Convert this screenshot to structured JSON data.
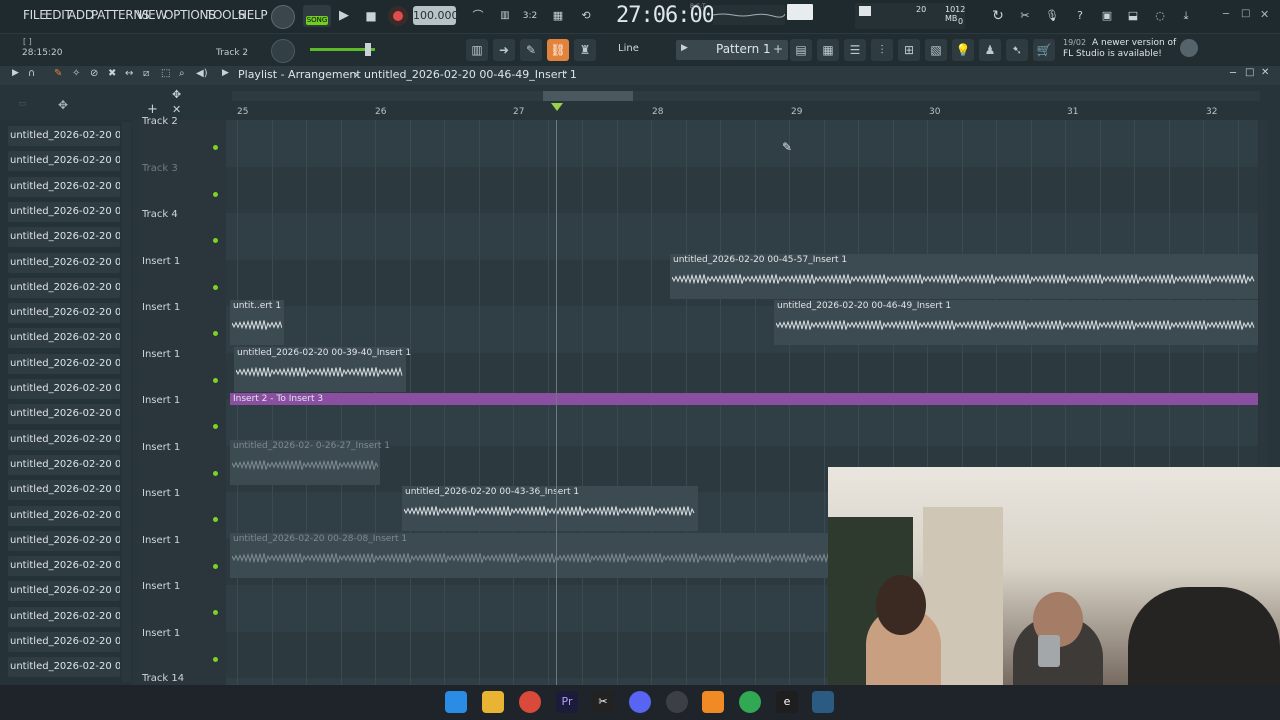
{
  "menu": [
    "FILE",
    "EDIT",
    "ADD",
    "PATTERNS",
    "VIEW",
    "OPTIONS",
    "TOOLS",
    "HELP"
  ],
  "transport": {
    "mode": "SONG",
    "tempo": "100.000",
    "time": "27:06:00",
    "time_small": "B:S:T",
    "cpu": "20",
    "mem": "1012 MB",
    "mem2": "0"
  },
  "hint": {
    "time": "28:15:20",
    "track": "Track 2"
  },
  "snap": "Line",
  "pattern": "Pattern 1",
  "news": {
    "date": "19/02",
    "line1": "A newer version of",
    "line2": "FL Studio is available!"
  },
  "playlist": {
    "label": "Playlist - Arrangement",
    "sep": "›",
    "file": "untitled_2026-02-20 00-46-49_Insert 1"
  },
  "bars": [
    "25",
    "26",
    "27",
    "28",
    "29",
    "30",
    "31",
    "32"
  ],
  "sidebar": [
    "untitled_2026-02-20 00-",
    "untitled_2026-02-20 00-",
    "untitled_2026-02-20 00-",
    "untitled_2026-02-20 00-",
    "untitled_2026-02-20 00-",
    "untitled_2026-02-20 00-",
    "untitled_2026-02-20 00-",
    "untitled_2026-02-20 00-",
    "untitled_2026-02-20 00-",
    "untitled_2026-02-20 00-",
    "untitled_2026-02-20 00-",
    "untitled_2026-02-20 00-",
    "untitled_2026-02-20 00-",
    "untitled_2026-02-20 00-",
    "untitled_2026-02-20 00-",
    "untitled_2026-02-20 00-",
    "untitled_2026-02-20 00-",
    "untitled_2026-02-20 00-",
    "untitled_2026-02-20 00-",
    "untitled_2026-02-20 00-",
    "untitled_2026-02-20 00-",
    "untitled_2026-02-20 00-"
  ],
  "tracks": [
    "Track 2",
    "Track 3",
    "Track 4",
    "Insert 1",
    "Insert 1",
    "Insert 1",
    "Insert 1",
    "Insert 1",
    "Insert 1",
    "Insert 1",
    "Insert 1",
    "Insert 1",
    "Track 14"
  ],
  "clips": {
    "c1": "untitled_2026-02-20 00-45-57_Insert 1",
    "c2": "untit..ert 1",
    "c3": "untitled_2026-02-20 00-46-49_Insert 1",
    "c4": "untitled_2026-02-20 00-39-40_Insert 1",
    "c5": "Insert 2 - To Insert 3",
    "c6": "untitled_2026-02- 0-26-27_Insert 1",
    "c7": "untitled_2026-02-20 00-43-36_Insert 1",
    "c8": "untitled_2026-02-20 00-28-08_Insert 1"
  }
}
